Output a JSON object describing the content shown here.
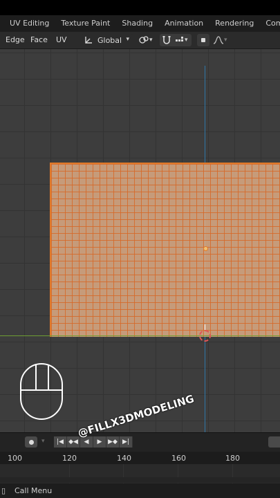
{
  "workspace_tabs": [
    "UV Editing",
    "Texture Paint",
    "Shading",
    "Animation",
    "Rendering",
    "Compositing"
  ],
  "header": {
    "menus": [
      "Edge",
      "Face",
      "UV"
    ],
    "orientation": "Global"
  },
  "viewport": {
    "colors": {
      "background": "#3d3d3d",
      "grid": "#333333",
      "mesh_fill": "#e4b088",
      "mesh_edges": "#d66828",
      "axis_x": "#6f9f33",
      "axis_y": "#2f77a7"
    }
  },
  "timeline": {
    "frame_numbers": [
      "100",
      "120",
      "140",
      "160",
      "180"
    ]
  },
  "status": {
    "call_menu": "Call Menu"
  },
  "watermark": "@FILLX3DMODELING",
  "icons": [
    "transform-orientation-icon",
    "snap-icon",
    "proportional-edit-icon",
    "overlay-icon",
    "record-icon",
    "play-icon",
    "mouse-icon"
  ]
}
